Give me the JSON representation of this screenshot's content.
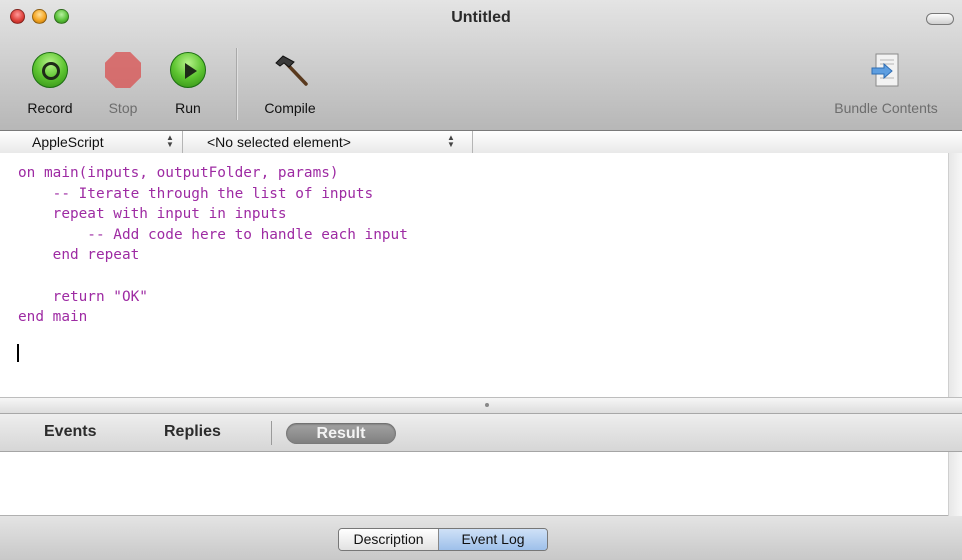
{
  "window": {
    "title": "Untitled"
  },
  "toolbar": {
    "record_label": "Record",
    "stop_label": "Stop",
    "run_label": "Run",
    "compile_label": "Compile",
    "bundle_label": "Bundle Contents",
    "icons": {
      "record": "record-icon",
      "stop": "stop-icon",
      "run": "play-icon",
      "compile": "hammer-icon",
      "bundle": "bundle-contents-icon"
    }
  },
  "navbar": {
    "language": "AppleScript",
    "element": "<No selected element>"
  },
  "editor": {
    "code": "on main(inputs, outputFolder, params)\n    -- Iterate through the list of inputs\n    repeat with input in inputs\n        -- Add code here to handle each input\n    end repeat\n\n    return \"OK\"\nend main",
    "code_color": "#9e2ba3"
  },
  "result_tabs": {
    "events": "Events",
    "replies": "Replies",
    "result": "Result",
    "selected": "Result"
  },
  "bottom_segment": {
    "description": "Description",
    "event_log": "Event Log",
    "selected": "Event Log"
  },
  "colors": {
    "accent": "#9ec0ea",
    "run_green": "#5ec531",
    "stop_red": "#d84f4f"
  }
}
